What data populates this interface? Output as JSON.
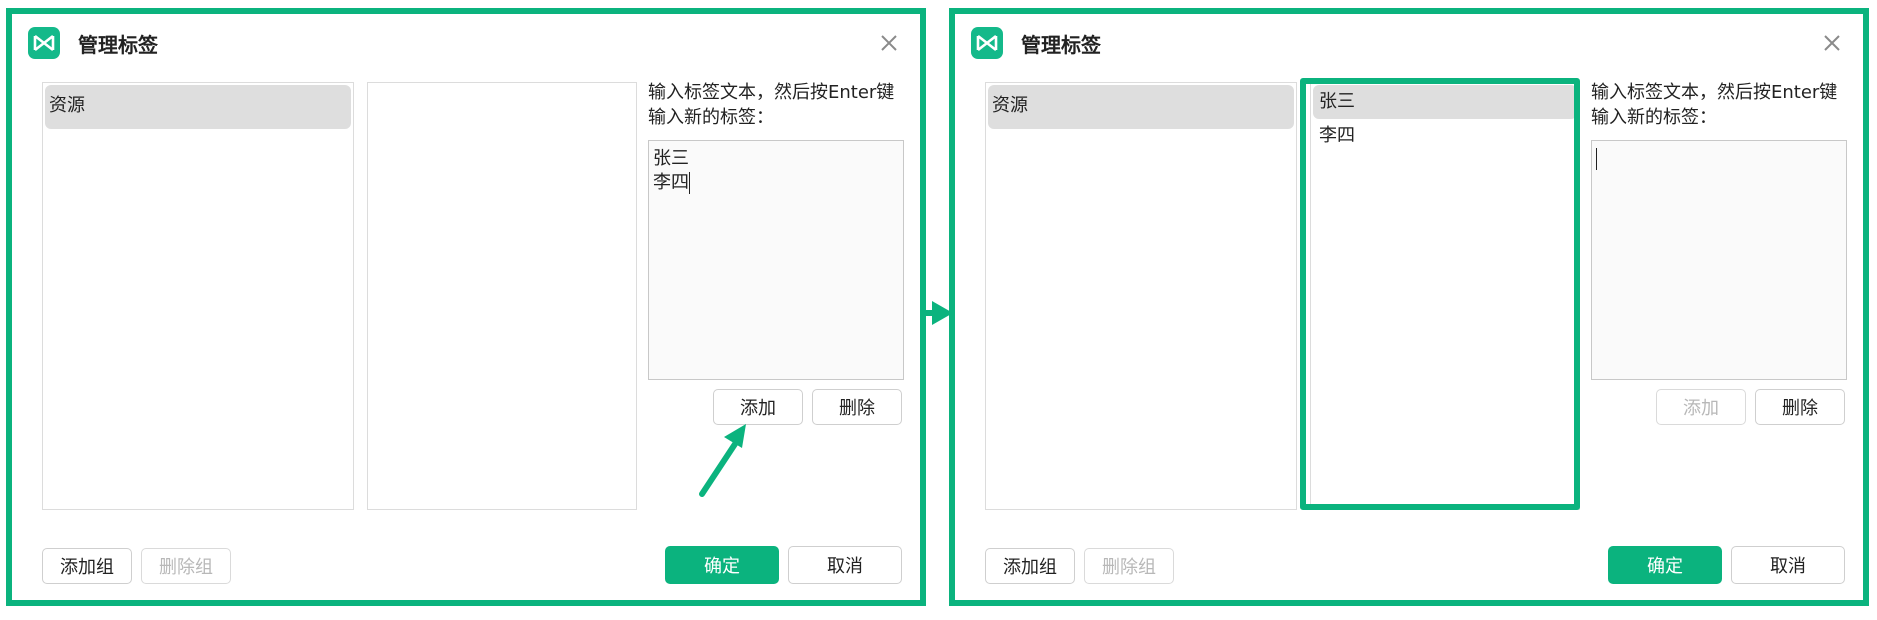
{
  "colors": {
    "accent": "#0bb37e",
    "selection": "#dedede"
  },
  "before": {
    "title": "管理标签",
    "groups": [
      {
        "label": "资源",
        "selected": true
      }
    ],
    "tags": [],
    "hint_line1": "输入标签文本，然后按Enter键",
    "hint_line2": "输入新的标签：",
    "entry_lines": [
      "张三",
      "李四"
    ],
    "add_label": "添加",
    "delete_label": "删除",
    "add_group_label": "添加组",
    "delete_group_label": "删除组",
    "ok_label": "确定",
    "cancel_label": "取消"
  },
  "after": {
    "title": "管理标签",
    "groups": [
      {
        "label": "资源",
        "selected": true
      }
    ],
    "tags": [
      {
        "label": "张三",
        "selected": true
      },
      {
        "label": "李四",
        "selected": false
      }
    ],
    "hint_line1": "输入标签文本，然后按Enter键",
    "hint_line2": "输入新的标签：",
    "entry_lines": [],
    "add_label": "添加",
    "delete_label": "删除",
    "add_group_label": "添加组",
    "delete_group_label": "删除组",
    "ok_label": "确定",
    "cancel_label": "取消"
  }
}
